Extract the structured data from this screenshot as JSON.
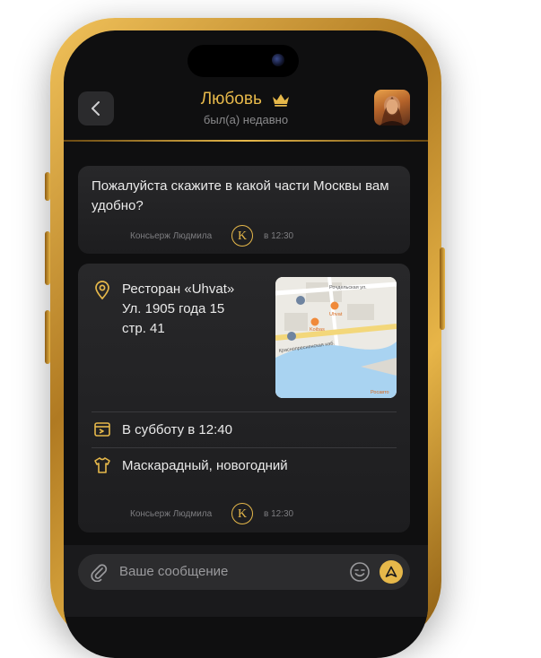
{
  "header": {
    "back_icon": "chevron-left-icon",
    "title": "Любовь",
    "crown_icon": "crown-icon",
    "status": "был(а) недавно",
    "accent_color": "#e6b84a"
  },
  "messages": [
    {
      "text": "Пожалуйста скажите в какой части Москвы вам удобно?",
      "sender": "Консьерж Людмила",
      "badge": "K",
      "time": "в 12:30"
    },
    {
      "venue_line1": "Ресторан «Uhvat»",
      "venue_line2": "Ул. 1905 года 15",
      "venue_line3": "стр. 41",
      "map_labels": {
        "street": "Рочдельская ул.",
        "embankment": "Краснопресненская наб.",
        "place1": "Uhvat",
        "place2": "Koibas",
        "brand": "Росавто"
      },
      "date_text": "В субботу в 12:40",
      "dress_code": "Маскарадный, новогодний",
      "sender": "Консьерж Людмила",
      "badge": "K",
      "time": "в 12:30"
    }
  ],
  "composer": {
    "placeholder": "Ваше сообщение",
    "attach_icon": "paperclip-icon",
    "emoji_icon": "smile-icon",
    "send_icon": "send-icon"
  }
}
